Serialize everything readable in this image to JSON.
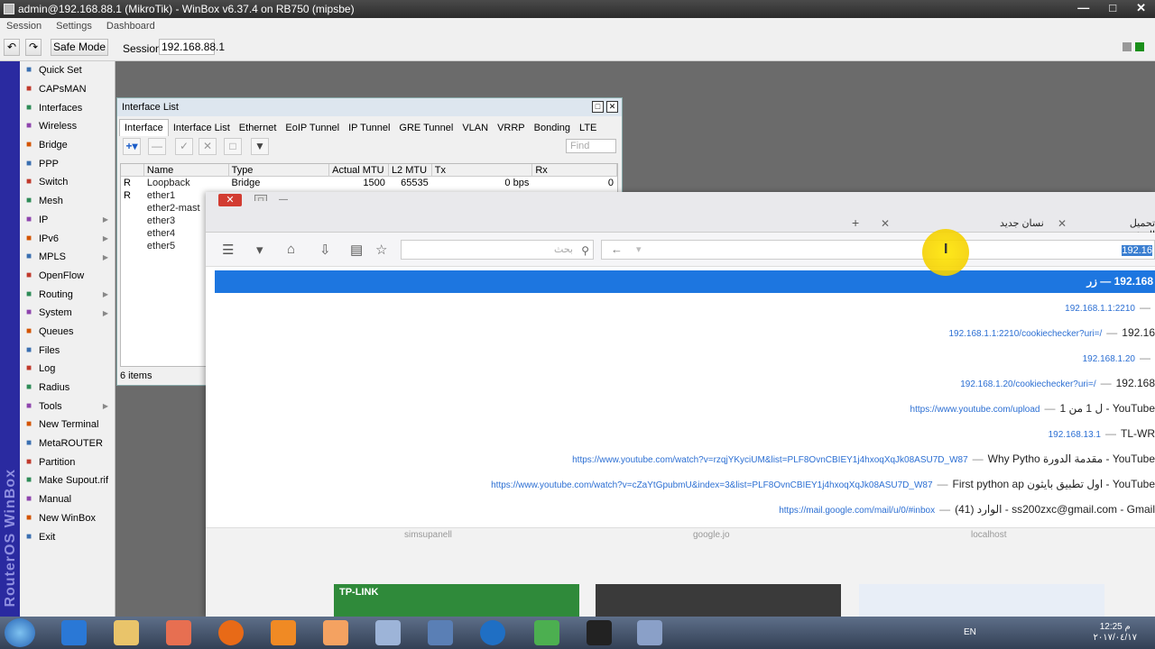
{
  "window": {
    "title": "admin@192.168.88.1 (MikroTik) - WinBox v6.37.4 on RB750 (mipsbe)"
  },
  "menu": [
    "Session",
    "Settings",
    "Dashboard"
  ],
  "toolbar": {
    "safe_mode": "Safe Mode",
    "session_label": "Session:",
    "session_value": "192.168.88.1"
  },
  "brand": "RouterOS WinBox",
  "sidebar": {
    "items": [
      {
        "label": "Quick Set",
        "icon": "quick-set-icon"
      },
      {
        "label": "CAPsMAN",
        "icon": "capsman-icon"
      },
      {
        "label": "Interfaces",
        "icon": "interfaces-icon"
      },
      {
        "label": "Wireless",
        "icon": "wireless-icon"
      },
      {
        "label": "Bridge",
        "icon": "bridge-icon"
      },
      {
        "label": "PPP",
        "icon": "ppp-icon"
      },
      {
        "label": "Switch",
        "icon": "switch-icon"
      },
      {
        "label": "Mesh",
        "icon": "mesh-icon"
      },
      {
        "label": "IP",
        "icon": "ip-icon",
        "submenu": true
      },
      {
        "label": "IPv6",
        "icon": "ipv6-icon",
        "submenu": true
      },
      {
        "label": "MPLS",
        "icon": "mpls-icon",
        "submenu": true
      },
      {
        "label": "OpenFlow",
        "icon": "openflow-icon"
      },
      {
        "label": "Routing",
        "icon": "routing-icon",
        "submenu": true
      },
      {
        "label": "System",
        "icon": "system-icon",
        "submenu": true
      },
      {
        "label": "Queues",
        "icon": "queues-icon"
      },
      {
        "label": "Files",
        "icon": "files-icon"
      },
      {
        "label": "Log",
        "icon": "log-icon"
      },
      {
        "label": "Radius",
        "icon": "radius-icon"
      },
      {
        "label": "Tools",
        "icon": "tools-icon",
        "submenu": true
      },
      {
        "label": "New Terminal",
        "icon": "terminal-icon"
      },
      {
        "label": "MetaROUTER",
        "icon": "metarouter-icon"
      },
      {
        "label": "Partition",
        "icon": "partition-icon"
      },
      {
        "label": "Make Supout.rif",
        "icon": "supout-icon"
      },
      {
        "label": "Manual",
        "icon": "manual-icon"
      },
      {
        "label": "New WinBox",
        "icon": "winbox-icon"
      },
      {
        "label": "Exit",
        "icon": "exit-icon"
      }
    ]
  },
  "interface_list": {
    "title": "Interface List",
    "tabs": [
      "Interface",
      "Interface List",
      "Ethernet",
      "EoIP Tunnel",
      "IP Tunnel",
      "GRE Tunnel",
      "VLAN",
      "VRRP",
      "Bonding",
      "LTE"
    ],
    "find_placeholder": "Find",
    "columns": [
      "Name",
      "Type",
      "Actual MTU",
      "L2 MTU",
      "Tx",
      "Rx"
    ],
    "rows": [
      {
        "flag": "R",
        "name": "Loopback",
        "type": "Bridge",
        "mtu": "1500",
        "l2mtu": "65535",
        "tx": "0 bps",
        "rx": "0"
      },
      {
        "flag": "R",
        "name": "ether1",
        "type": "",
        "mtu": "",
        "l2mtu": "",
        "tx": "",
        "rx": ""
      },
      {
        "flag": "",
        "name": "ether2-mast",
        "type": "",
        "mtu": "",
        "l2mtu": "",
        "tx": "",
        "rx": ""
      },
      {
        "flag": "",
        "name": "ether3",
        "type": "",
        "mtu": "",
        "l2mtu": "",
        "tx": "",
        "rx": ""
      },
      {
        "flag": "",
        "name": "ether4",
        "type": "",
        "mtu": "",
        "l2mtu": "",
        "tx": "",
        "rx": ""
      },
      {
        "flag": "",
        "name": "ether5",
        "type": "",
        "mtu": "",
        "l2mtu": "",
        "tx": "",
        "rx": ""
      }
    ],
    "footer": "6 items"
  },
  "browser": {
    "tab1": "نسان جديد",
    "tab2": "تحميل الصفحة",
    "search_placeholder": "بحث",
    "url_typed": "192.16",
    "suggest_head": "192.168 — زر",
    "suggestions": [
      {
        "title": "",
        "url": "192.168.1.1:2210"
      },
      {
        "title": "192.16",
        "url": "192.168.1.1:2210/cookiechecker?uri=/"
      },
      {
        "title": "",
        "url": "192.168.1.20"
      },
      {
        "title": "192.168",
        "url": "192.168.1.20/cookiechecker?uri=/"
      },
      {
        "title": "ل 1 من 1 - YouTube",
        "url": "https://www.youtube.com/upload"
      },
      {
        "title": "TL-WR",
        "url": "192.168.13.1"
      },
      {
        "title": "Why Pytho مقدمة الدورة - YouTube",
        "url": "https://www.youtube.com/watch?v=rzqjYKyciUM&list=PLF8OvnCBIEY1j4hxoqXqJk08ASU7D_W87"
      },
      {
        "title": "First python ap اول تطبيق بايثون - YouTube",
        "url": "https://www.youtube.com/watch?v=cZaYtGpubmU&index=3&list=PLF8OvnCBIEY1j4hxoqXqJk08ASU7D_W87"
      },
      {
        "title": "الوارد (41) - ss200zxc@gmail.com - Gmail",
        "url": "https://mail.google.com/mail/u/0/#inbox"
      }
    ],
    "tile_texts": [
      "simsupanell",
      "google.jo",
      "localhost"
    ],
    "tile_brand": "TP-LINK"
  },
  "taskbar": {
    "lang": "EN",
    "time": "12:25 م",
    "date": "٢٠١٧/٠٤/١٧"
  }
}
